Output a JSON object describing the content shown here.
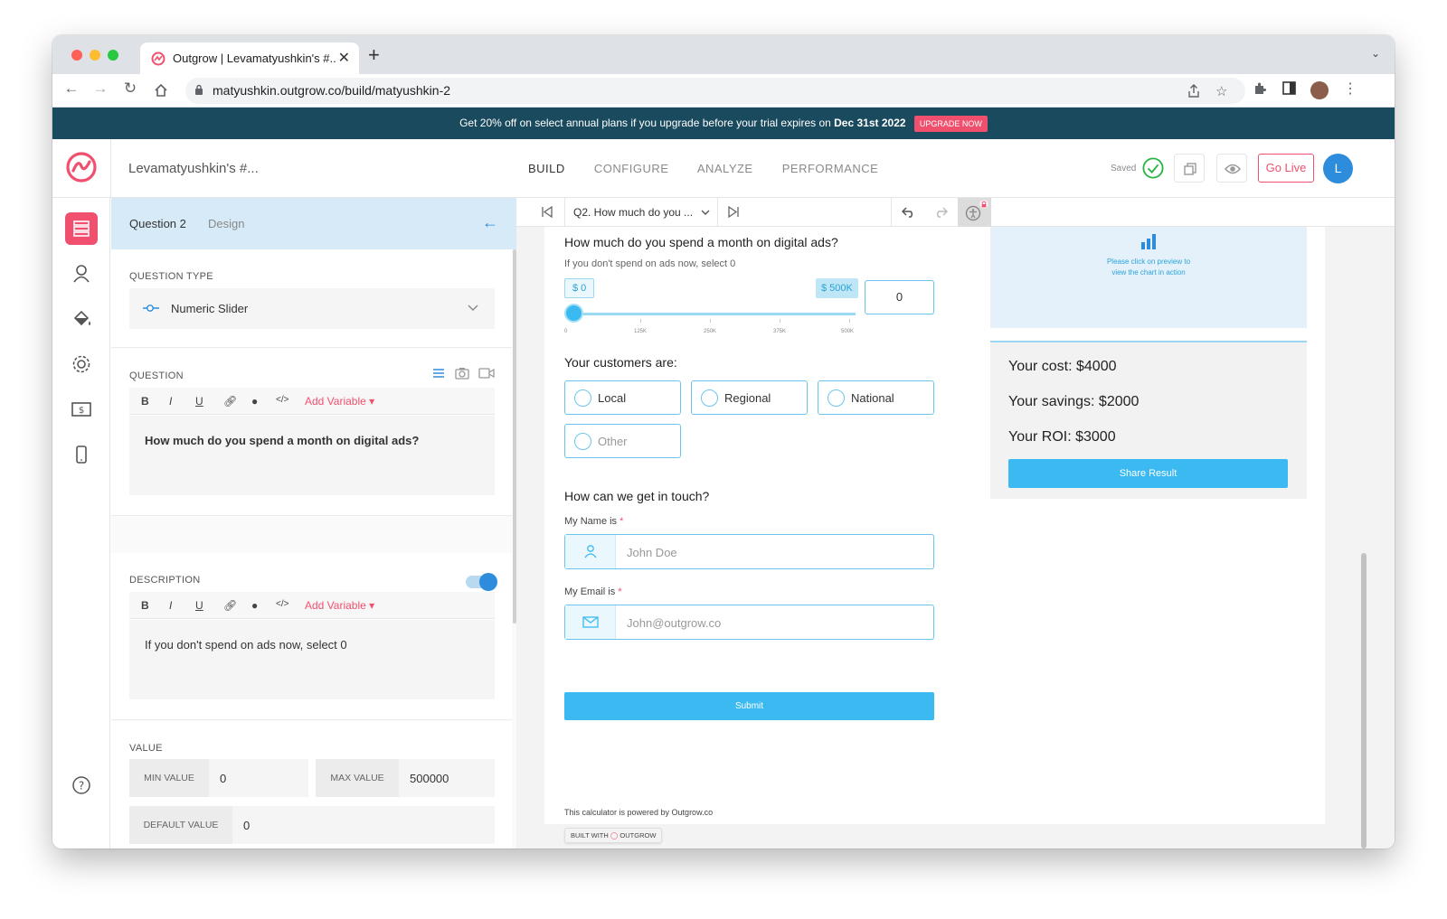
{
  "browser": {
    "tab_title": "Outgrow | Levamatyushkin's #...",
    "url": "matyushkin.outgrow.co/build/matyushkin-2"
  },
  "promo": {
    "text": "Get 20% off on select annual plans if you upgrade before your trial expires on",
    "date": "Dec 31st 2022",
    "button": "UPGRADE NOW"
  },
  "header": {
    "project_name": "Levamatyushkin's #...",
    "nav": [
      "BUILD",
      "CONFIGURE",
      "ANALYZE",
      "PERFORMANCE"
    ],
    "saved": "Saved",
    "go_live": "Go Live",
    "avatar": "L"
  },
  "left_panel": {
    "tabs": [
      "Question 2",
      "Design"
    ],
    "question_type_label": "QUESTION TYPE",
    "question_type_value": "Numeric Slider",
    "question_label": "QUESTION",
    "question_text": "How much do you spend a month on digital ads?",
    "description_label": "DESCRIPTION",
    "description_text": "If you don't spend on ads now, select 0",
    "add_variable": "Add Variable",
    "editor_buttons": [
      "B",
      "I",
      "U"
    ],
    "value_label": "VALUE",
    "min_label": "MIN VALUE",
    "min_value": "0",
    "max_label": "MAX VALUE",
    "max_value": "500000",
    "default_label": "DEFAULT VALUE",
    "default_value": "0"
  },
  "question_bar": {
    "selected": "Q2. How much do you ..."
  },
  "preview": {
    "q_title": "How much do you spend a month on digital ads?",
    "q_desc": "If you don't spend on ads now, select 0",
    "slider_min": "$ 0",
    "slider_max": "$ 500K",
    "slider_ticks": [
      "0",
      "125K",
      "250K",
      "375K",
      "500K"
    ],
    "slider_value": "0",
    "slider_fraction": 0,
    "customers_title": "Your customers are:",
    "options": [
      "Local",
      "Regional",
      "National",
      "Other"
    ],
    "contact_title": "How can we get in touch?",
    "name_label": "My Name is",
    "name_placeholder": "John Doe",
    "email_label": "My Email is",
    "email_placeholder": "John@outgrow.co",
    "required_mark": "*",
    "submit": "Submit",
    "powered": "This calculator is powered by Outgrow.co",
    "built_with": "BUILT WITH",
    "built_brand": "OUTGROW"
  },
  "results": {
    "chart_hint_1": "Please click on preview to",
    "chart_hint_2": "view the chart in action",
    "cost": "Your cost: $4000",
    "savings": "Your savings: $2000",
    "roi": "Your ROI: $3000",
    "share": "Share Result"
  },
  "colors": {
    "brand": "#f0506e",
    "accent": "#3bbaf1",
    "banner": "#1a4a5e"
  }
}
